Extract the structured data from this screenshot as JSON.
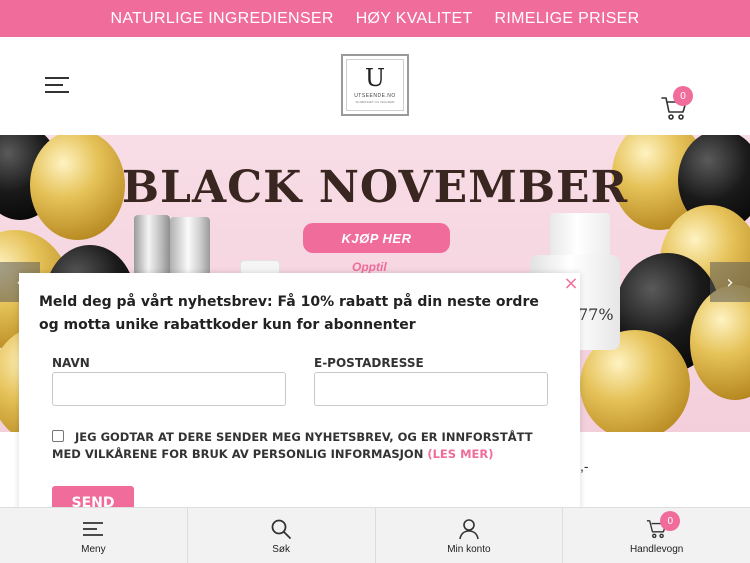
{
  "topbar": {
    "items": [
      "NATURLIGE INGREDIENSER",
      "HØY KVALITET",
      "RIMELIGE PRISER"
    ]
  },
  "header": {
    "logo": {
      "letter": "U",
      "name": "UTSEENDE.NO",
      "tagline": "SKJØNNHET OG VELVÆRE"
    },
    "cart_count": "0"
  },
  "banner": {
    "title": "BLACK NOVEMBER",
    "cta_label": "KJØP HER",
    "subtext": "Opptil",
    "bottle_text": "77%",
    "prev_arrow": "‹",
    "next_arrow": "›"
  },
  "background_fragment": ",-",
  "newsletter": {
    "close_glyph": "×",
    "heading": "Meld deg på vårt nyhetsbrev: Få 10% rabatt på din neste ordre og motta unike rabattkoder kun for abonnenter",
    "name_label": "NAVN",
    "name_value": "",
    "email_label": "E-POSTADRESSE",
    "email_value": "",
    "consent_text": "JEG GODTAR AT DERE SENDER MEG NYHETSBREV, OG ER INNFORSTÅTT MED VILKÅRENE FOR BRUK AV PERSONLIG INFORMASJON",
    "consent_link": "(LES MER)",
    "consent_checked": false,
    "submit_label": "SEND"
  },
  "bottom_nav": {
    "items": [
      {
        "label": "Meny",
        "icon": "menu-icon"
      },
      {
        "label": "Søk",
        "icon": "search-icon"
      },
      {
        "label": "Min konto",
        "icon": "user-icon"
      },
      {
        "label": "Handlevogn",
        "icon": "cart-icon"
      }
    ],
    "cart_count": "0"
  },
  "colors": {
    "brand_pink": "#f06d9b",
    "banner_bg": "#f8dde6",
    "nav_bg": "#f2f2f2"
  }
}
